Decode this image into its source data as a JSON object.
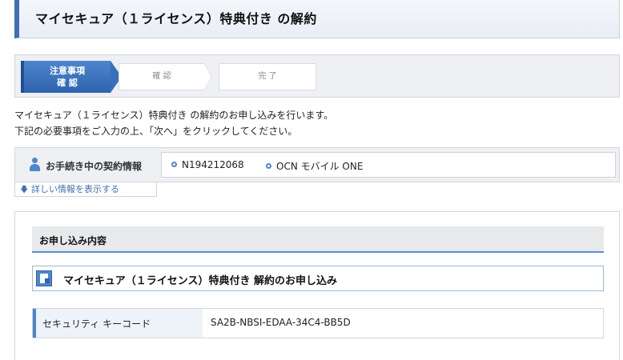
{
  "page": {
    "title": "マイセキュア（１ライセンス）特典付き の解約"
  },
  "steps": {
    "step1_line1": "注意事項",
    "step1_line2": "確 認",
    "step2": "確 認",
    "step3": "完 了"
  },
  "intro": {
    "line1": "マイセキュア（１ライセンス）特典付き の解約のお申し込みを行います。",
    "line2": "下記の必要事項をご入力の上、「次へ」をクリックしてください。"
  },
  "contract": {
    "label": "お手続き中の契約情報",
    "id": "N194212068",
    "service": "OCN モバイル ONE",
    "details_link": "詳しい情報を表示する"
  },
  "application": {
    "section_title": "お申し込み内容",
    "item_title": "マイセキュア（１ライセンス）特典付き 解約のお申し込み",
    "security_key_label": "セキュリティ キーコード",
    "security_key_value": "SA2B-NBSI-EDAA-34C4-BB5D"
  }
}
